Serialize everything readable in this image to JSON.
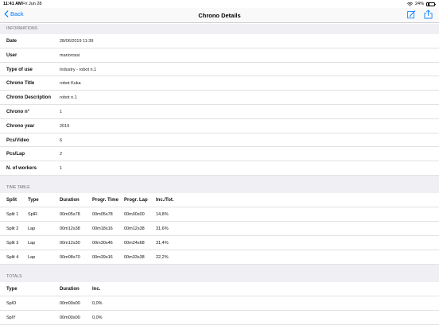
{
  "status_bar": {
    "time": "11:41 AM",
    "date": "Fri Jun 28",
    "battery": "24%"
  },
  "nav": {
    "back_label": "Back",
    "title": "Chrono Details"
  },
  "informations": {
    "header": "INFORMATIONS",
    "rows": [
      {
        "label": "Date",
        "value": "28/06/2019 11:39"
      },
      {
        "label": "User",
        "value": "mariorossi"
      },
      {
        "label": "Type of use",
        "value": "Industry - robot n.1"
      },
      {
        "label": "Chrono Title",
        "value": "robot Kuka"
      },
      {
        "label": "Chrono Description",
        "value": "robot n.1"
      },
      {
        "label": "Chrono n°",
        "value": "1"
      },
      {
        "label": "Chrono year",
        "value": "2019"
      },
      {
        "label": "Pcs/Video",
        "value": "6"
      },
      {
        "label": "Pcs/Lap",
        "value": "2"
      },
      {
        "label": "N. of workers",
        "value": "1"
      }
    ]
  },
  "time_table": {
    "header": "TIME TABLE",
    "columns": [
      "Split",
      "Type",
      "Duration",
      "Progr. Time",
      "Progr. Lap",
      "Inc./Tot."
    ],
    "rows": [
      [
        "Split 1",
        "SplR",
        "00m05s78",
        "00m05s78",
        "00m00s00",
        "14,8%"
      ],
      [
        "Split 2",
        "Lap",
        "00m12s38",
        "00m18s16",
        "00m12s38",
        "31,6%"
      ],
      [
        "Split 3",
        "Lap",
        "00m12s30",
        "00m30s46",
        "00m24s68",
        "31,4%"
      ],
      [
        "Split 4",
        "Lap",
        "00m08s70",
        "00m39s16",
        "00m33s38",
        "22,2%"
      ]
    ]
  },
  "totals": {
    "header": "TOTALS",
    "columns": [
      "Type",
      "Duration",
      "Inc."
    ],
    "rows": [
      [
        "SplO",
        "00m00s00",
        "0,0%"
      ],
      [
        "SplY",
        "00m00s00",
        "0,0%"
      ]
    ]
  }
}
